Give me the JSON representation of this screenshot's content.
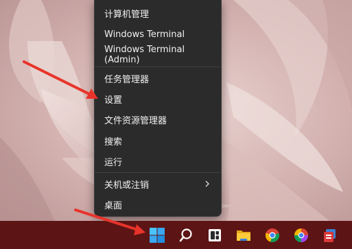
{
  "context_menu": {
    "items": [
      {
        "label": "计算机管理"
      },
      {
        "label": "Windows Terminal"
      },
      {
        "label": "Windows Terminal (Admin)"
      },
      {
        "label": "任务管理器"
      },
      {
        "label": "设置"
      },
      {
        "label": "文件资源管理器"
      },
      {
        "label": "搜索"
      },
      {
        "label": "运行"
      },
      {
        "label": "关机或注销",
        "has_submenu": true
      },
      {
        "label": "桌面"
      }
    ]
  },
  "taskbar": {
    "icons": [
      "windows-start-icon",
      "search-icon",
      "widgets-icon",
      "file-explorer-icon",
      "chrome-icon",
      "chrome-color-icon",
      "app-icon"
    ]
  },
  "colors": {
    "menu_bg": "#2b2b2b",
    "taskbar_bg": "#5c1414",
    "annotation_arrow": "#e8332a"
  }
}
